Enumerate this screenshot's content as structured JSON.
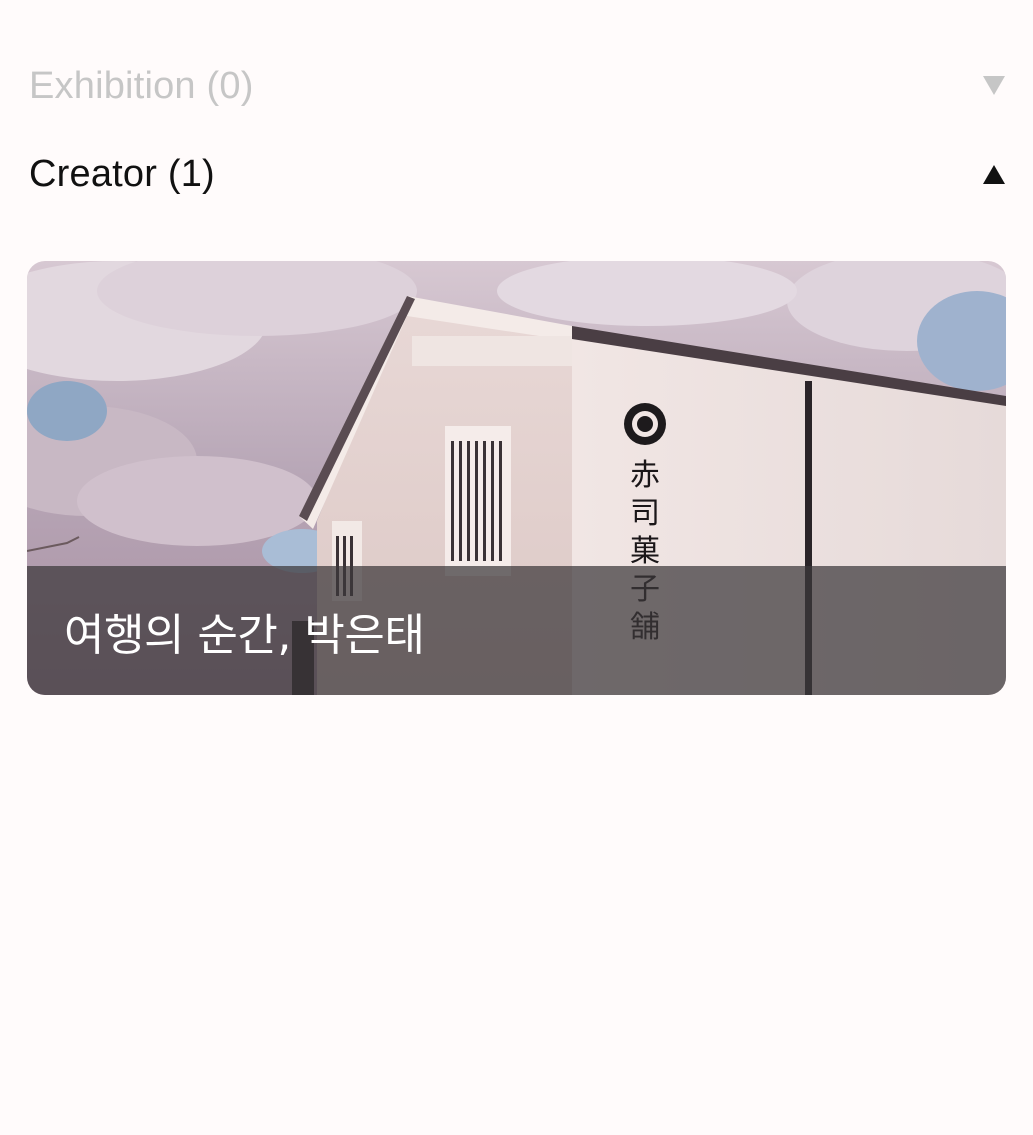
{
  "sections": {
    "exhibition": {
      "label": "Exhibition (0)",
      "expanded": false,
      "arrow_icon": "triangle-down-icon"
    },
    "creator": {
      "label": "Creator (1)",
      "expanded": true,
      "arrow_icon": "triangle-up-icon"
    }
  },
  "creator_items": [
    {
      "title": "여행의 순간, 박은태",
      "image": "white-japanese-storehouse-photo"
    }
  ],
  "signage": {
    "characters": [
      "赤",
      "司",
      "菓",
      "子",
      "舗"
    ]
  },
  "colors": {
    "background": "#fffbfb",
    "muted_text": "#c6c6c6",
    "primary_text": "#111111",
    "overlay": "#3c383a",
    "overlay_text": "#ffffff"
  }
}
